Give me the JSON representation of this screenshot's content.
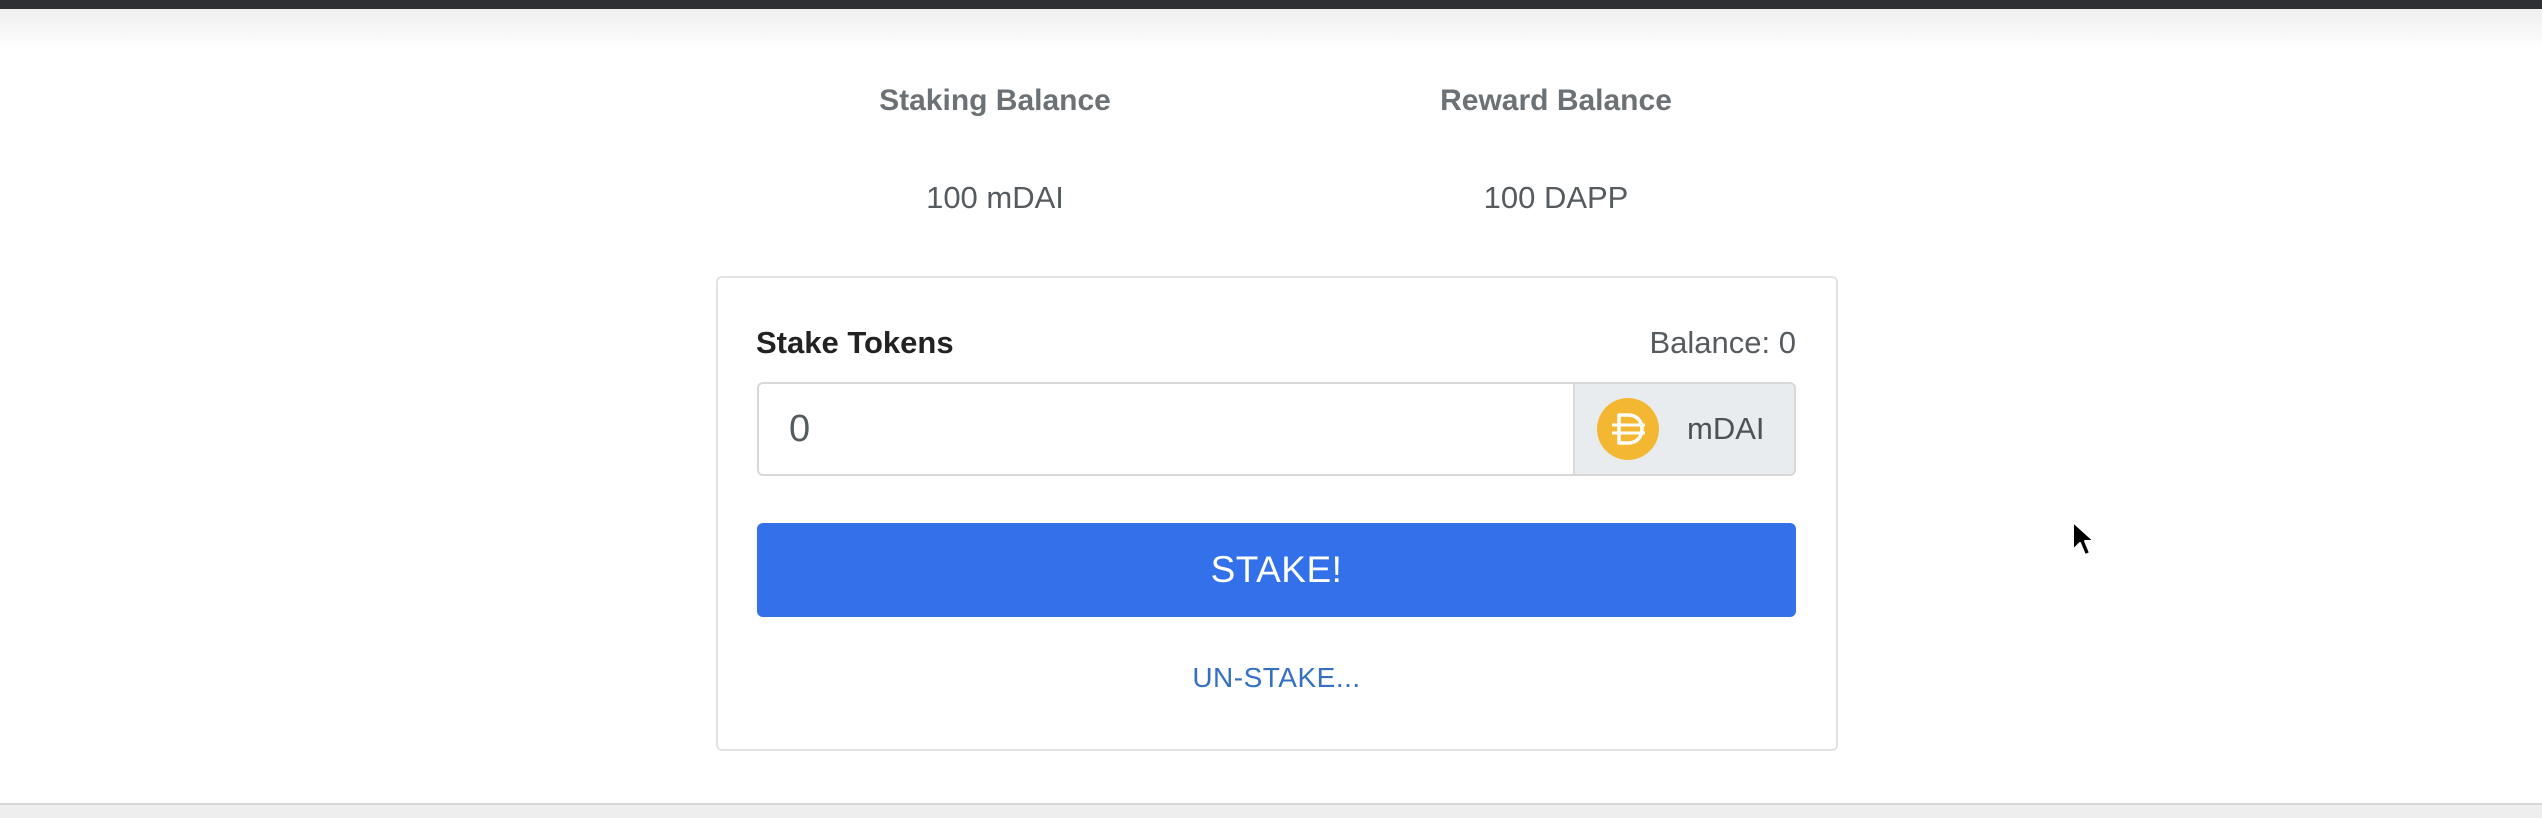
{
  "balances": {
    "staking": {
      "label": "Staking Balance",
      "value": "100 mDAI"
    },
    "reward": {
      "label": "Reward Balance",
      "value": "100 DAPP"
    }
  },
  "stake_form": {
    "title": "Stake Tokens",
    "balance_label": "Balance: 0",
    "amount_value": "0",
    "token": {
      "name": "mDAI",
      "icon": "dai-token-icon",
      "icon_color": "#f4b731"
    },
    "stake_button_label": "STAKE!",
    "unstake_link_label": "UN-STAKE..."
  },
  "colors": {
    "primary": "#3371ea",
    "link": "#3470c4"
  }
}
